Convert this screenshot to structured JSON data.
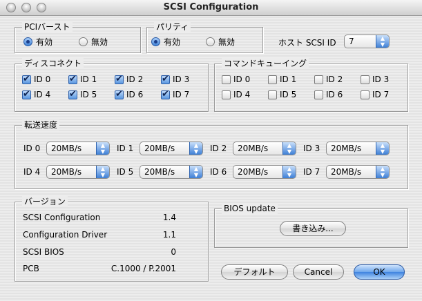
{
  "window": {
    "title": "SCSI Configuration"
  },
  "pci_burst": {
    "legend": "PCIバースト",
    "options": [
      "有効",
      "無効"
    ],
    "selected": 0
  },
  "parity": {
    "legend": "パリティ",
    "options": [
      "有効",
      "無効"
    ],
    "selected": 0
  },
  "host": {
    "label": "ホスト SCSI ID",
    "value": "7"
  },
  "disconnect": {
    "legend": "ディスコネクト",
    "items": [
      {
        "label": "ID 0",
        "checked": true
      },
      {
        "label": "ID 1",
        "checked": true
      },
      {
        "label": "ID 2",
        "checked": true
      },
      {
        "label": "ID 3",
        "checked": true
      },
      {
        "label": "ID 4",
        "checked": true
      },
      {
        "label": "ID 5",
        "checked": true
      },
      {
        "label": "ID 6",
        "checked": true
      },
      {
        "label": "ID 7",
        "checked": true
      }
    ]
  },
  "command_queue": {
    "legend": "コマンドキューイング",
    "items": [
      {
        "label": "ID 0",
        "checked": false
      },
      {
        "label": "ID 1",
        "checked": false
      },
      {
        "label": "ID 2",
        "checked": false
      },
      {
        "label": "ID 3",
        "checked": false
      },
      {
        "label": "ID 4",
        "checked": false
      },
      {
        "label": "ID 5",
        "checked": false
      },
      {
        "label": "ID 6",
        "checked": false
      },
      {
        "label": "ID 7",
        "checked": false
      }
    ]
  },
  "transfer": {
    "legend": "転送速度",
    "items": [
      {
        "label": "ID 0",
        "value": "20MB/s"
      },
      {
        "label": "ID 1",
        "value": "20MB/s"
      },
      {
        "label": "ID 2",
        "value": "20MB/s"
      },
      {
        "label": "ID 3",
        "value": "20MB/s"
      },
      {
        "label": "ID 4",
        "value": "20MB/s"
      },
      {
        "label": "ID 5",
        "value": "20MB/s"
      },
      {
        "label": "ID 6",
        "value": "20MB/s"
      },
      {
        "label": "ID 7",
        "value": "20MB/s"
      }
    ]
  },
  "version": {
    "legend": "バージョン",
    "rows": [
      {
        "name": "SCSI Configuration",
        "value": "1.4"
      },
      {
        "name": "Configuration Driver",
        "value": "1.1"
      },
      {
        "name": "SCSI BIOS",
        "value": "0"
      },
      {
        "name": "PCB",
        "value": "C.1000 / P.2001"
      }
    ]
  },
  "bios": {
    "legend": "BIOS update",
    "write_label": "書き込み..."
  },
  "buttons": {
    "default_label": "デフォルト",
    "cancel_label": "Cancel",
    "ok_label": "OK"
  }
}
